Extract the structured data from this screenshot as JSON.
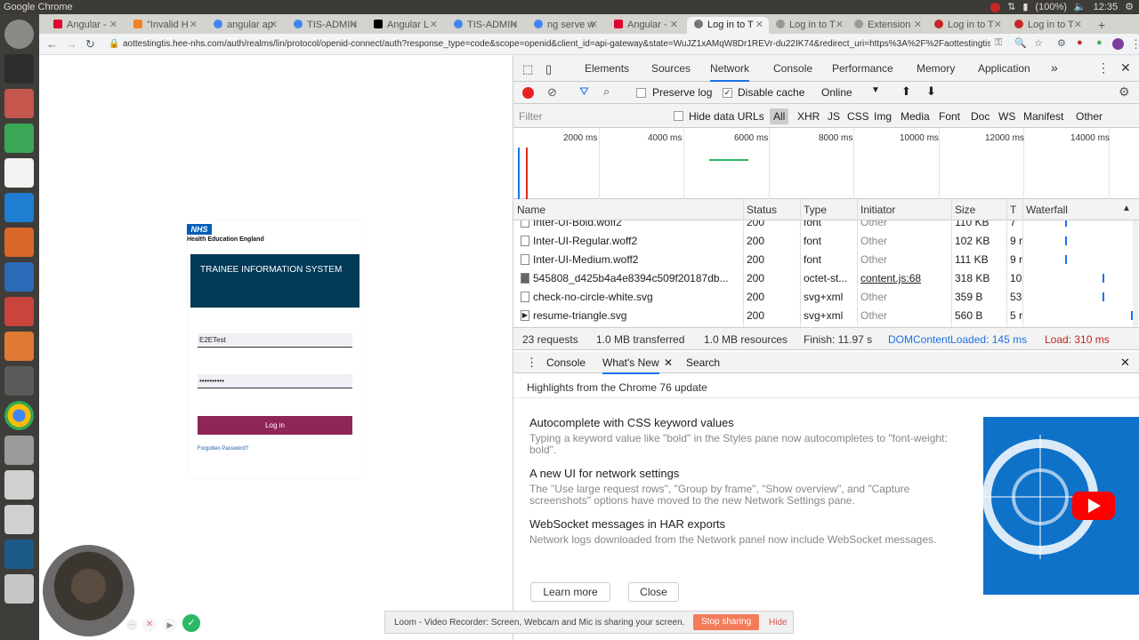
{
  "system": {
    "app_name": "Google Chrome",
    "battery": "(100%)",
    "time": "12:35"
  },
  "tabs": [
    {
      "label": "Angular - ",
      "favicon_color": "#dd0031"
    },
    {
      "label": "\"Invalid H",
      "favicon_color": "#f48024"
    },
    {
      "label": "angular ap",
      "favicon_color": "#4285f4"
    },
    {
      "label": "TIS-ADMIN",
      "favicon_color": "#4285f4"
    },
    {
      "label": "Angular L",
      "favicon_color": "#000000"
    },
    {
      "label": "TIS-ADMIN",
      "favicon_color": "#4285f4"
    },
    {
      "label": "ng serve w",
      "favicon_color": "#4285f4"
    },
    {
      "label": "Angular - ",
      "favicon_color": "#dd0031"
    },
    {
      "label": "Log in to T",
      "favicon_color": "#777777",
      "active": true
    },
    {
      "label": "Log in to T",
      "favicon_color": "#777777"
    },
    {
      "label": "Extension",
      "favicon_color": "#777777"
    },
    {
      "label": "Log in to T",
      "favicon_color": "#c62828"
    },
    {
      "label": "Log in to T",
      "favicon_color": "#c62828"
    }
  ],
  "address": {
    "url": "aottestingtis.hee-nhs.com/auth/realms/lin/protocol/openid-connect/auth?response_type=code&scope=openid&client_id=api-gateway&state=WuJZ1xAMqW8Dr1REVr-du22IK74&redirect_uri=https%3A%2F%2Faottestingtis.hee-..."
  },
  "login": {
    "logo": "NHS",
    "org": "Health Education England",
    "banner": "TRAINEE INFORMATION SYSTEM",
    "username": "E2ETest",
    "password": "••••••••••",
    "button": "Log in",
    "forgot": "Forgotten Password?"
  },
  "devtools": {
    "tabs": [
      "Elements",
      "Sources",
      "Network",
      "Console",
      "Performance",
      "Memory",
      "Application"
    ],
    "active_tab": "Network",
    "more": "»",
    "toolbar": {
      "preserve_log": "Preserve log",
      "disable_cache": "Disable cache",
      "throttle": "Online"
    },
    "filter": {
      "placeholder": "Filter",
      "hide_data_urls": "Hide data URLs",
      "types": [
        "All",
        "XHR",
        "JS",
        "CSS",
        "Img",
        "Media",
        "Font",
        "Doc",
        "WS",
        "Manifest",
        "Other"
      ]
    },
    "overview_ticks": [
      "2000 ms",
      "4000 ms",
      "6000 ms",
      "8000 ms",
      "10000 ms",
      "12000 ms",
      "14000 ms"
    ],
    "columns": [
      "Name",
      "Status",
      "Type",
      "Initiator",
      "Size",
      "T",
      "Waterfall"
    ],
    "rows": [
      {
        "name": "Inter-UI-Bold.woff2",
        "status": "200",
        "type": "font",
        "initiator": "Other",
        "size": "110 KB",
        "time": "7"
      },
      {
        "name": "Inter-UI-Regular.woff2",
        "status": "200",
        "type": "font",
        "initiator": "Other",
        "size": "102 KB",
        "time": "9 r"
      },
      {
        "name": "Inter-UI-Medium.woff2",
        "status": "200",
        "type": "font",
        "initiator": "Other",
        "size": "111 KB",
        "time": "9 r"
      },
      {
        "name": "545808_d425b4a4e8394c509f20187db...",
        "status": "200",
        "type": "octet-st...",
        "initiator": "content.js:68",
        "size": "318 KB",
        "time": "10"
      },
      {
        "name": "check-no-circle-white.svg",
        "status": "200",
        "type": "svg+xml",
        "initiator": "Other",
        "size": "359 B",
        "time": "53"
      },
      {
        "name": "resume-triangle.svg",
        "status": "200",
        "type": "svg+xml",
        "initiator": "Other",
        "size": "560 B",
        "time": "5 r"
      }
    ],
    "summary": {
      "requests": "23 requests",
      "transferred": "1.0 MB transferred",
      "resources": "1.0 MB resources",
      "finish": "Finish: 11.97 s",
      "dcl": "DOMContentLoaded: 145 ms",
      "load": "Load: 310 ms"
    },
    "drawer": {
      "tabs": [
        "Console",
        "What's New",
        "Search"
      ],
      "active": "What's New",
      "heading": "Highlights from the Chrome 76 update",
      "items": [
        {
          "title": "Autocomplete with CSS keyword values",
          "desc": "Typing a keyword value like \"bold\" in the Styles pane now autocompletes to \"font-weight: bold\"."
        },
        {
          "title": "A new UI for network settings",
          "desc": "The \"Use large request rows\", \"Group by frame\", \"Show overview\", and \"Capture screenshots\" options have moved to the new Network Settings pane."
        },
        {
          "title": "WebSocket messages in HAR exports",
          "desc": "Network logs downloaded from the Network panel now include WebSocket messages."
        }
      ],
      "learn_more": "Learn more",
      "close": "Close"
    }
  },
  "loom": {
    "message": "Loom - Video Recorder: Screen, Webcam and Mic is sharing your screen.",
    "stop": "Stop sharing",
    "hide": "Hide"
  }
}
